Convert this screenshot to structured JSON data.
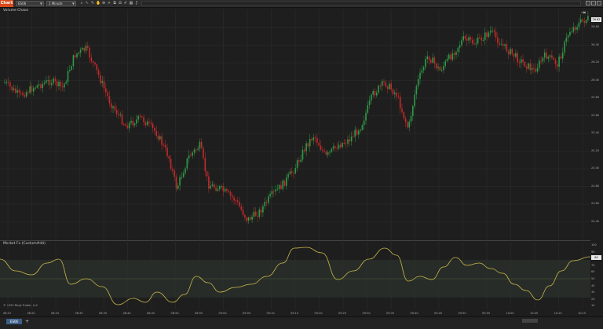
{
  "toolbar": {
    "chart_label": "Chart",
    "instrument": "ES06",
    "interval": "1 Minute"
  },
  "main_pane": {
    "title": "Volume Chaos",
    "y_labels": [
      "26.80",
      "26.40",
      "26.20",
      "26.00",
      "25.80",
      "25.60",
      "25.40",
      "25.20",
      "25.00",
      "24.80",
      "24.60",
      "24.40"
    ],
    "last_price": "26.62"
  },
  "indicator": {
    "title": "Market Fx (Custom#d4)",
    "y_labels": [
      "100",
      "90",
      "80",
      "70",
      "60",
      "50",
      "40",
      "30",
      "20",
      "10"
    ],
    "last_value": "60",
    "copyright": "© 2023 Ninja Trader, LLC"
  },
  "x_labels": [
    "08:15",
    "08:20",
    "08:25",
    "08:30",
    "08:35",
    "08:40",
    "08:45",
    "08:50",
    "08:55",
    "09:00",
    "09:05",
    "09:10",
    "09:15",
    "09:20",
    "09:25",
    "09:30",
    "09:35",
    "09:40",
    "09:45",
    "09:50",
    "09:55",
    "10:00",
    "10:05",
    "10:10",
    "10:15"
  ],
  "footer": {
    "tab_label": "ES06"
  },
  "colors": {
    "up": "#2e9b47",
    "down": "#c42a2a",
    "osc": "#c8b84a",
    "accent": "#d84a1b"
  }
}
